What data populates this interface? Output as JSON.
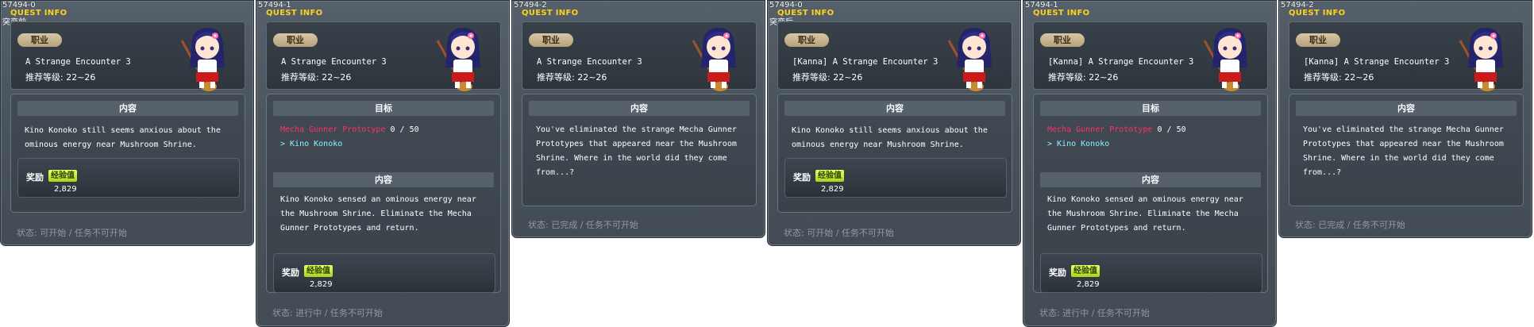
{
  "panels": [
    {
      "id": "57494-0",
      "header": "QUEST INFO",
      "sublabel": "突变前",
      "badge": "职业",
      "name": "A Strange Encounter 3",
      "level": "推荐等级: 22~26",
      "section": "内容",
      "description": [
        "Kino Konoko still seems anxious about the",
        "ominous energy near Mushroom Shrine."
      ],
      "reward_label": "奖励",
      "reward_type": "经验值",
      "reward_value": "2,829",
      "status": "状态:  可开始 / 任务不可开始"
    },
    {
      "id": "57494-1",
      "header": "QUEST INFO",
      "sublabel": "",
      "badge": "职业",
      "name": "A Strange Encounter 3",
      "level": "推荐等级: 22~26",
      "goal_label": "目标",
      "target_mob": "Mecha Gunner Prototype",
      "target_count": "0 / 50",
      "target_npc": "> Kino Konoko",
      "section": "内容",
      "description": [
        "Kino Konoko sensed an ominous energy near",
        "the Mushroom Shrine. Eliminate the Mecha",
        "Gunner Prototypes and return."
      ],
      "reward_label": "奖励",
      "reward_type": "经验值",
      "reward_value": "2,829",
      "status": "状态:  进行中 / 任务不可开始"
    },
    {
      "id": "57494-2",
      "header": "QUEST INFO",
      "sublabel": "",
      "badge": "职业",
      "name": "A Strange Encounter 3",
      "level": "推荐等级: 22~26",
      "section": "内容",
      "description": [
        "You've eliminated the strange Mecha Gunner",
        "Prototypes that appeared near the Mushroom",
        "Shrine. Where in the world did they come",
        "from...?"
      ],
      "status": "状态:  已完成 / 任务不可开始"
    },
    {
      "id": "57494-0",
      "header": "QUEST INFO",
      "sublabel": "突变后",
      "badge": "职业",
      "name": "[Kanna] A Strange Encounter 3",
      "level": "推荐等级: 22~26",
      "section": "内容",
      "description": [
        "Kino Konoko still seems anxious about the",
        "ominous energy near Mushroom Shrine."
      ],
      "reward_label": "奖励",
      "reward_type": "经验值",
      "reward_value": "2,829",
      "status": "状态:  可开始 / 任务不可开始"
    },
    {
      "id": "57494-1",
      "header": "QUEST INFO",
      "sublabel": "",
      "badge": "职业",
      "name": "[Kanna] A Strange Encounter 3",
      "level": "推荐等级: 22~26",
      "goal_label": "目标",
      "target_mob": "Mecha Gunner Prototype",
      "target_count": "0 / 50",
      "target_npc": "> Kino Konoko",
      "section": "内容",
      "description": [
        "Kino Konoko sensed an ominous energy near",
        "the Mushroom Shrine. Eliminate the Mecha",
        "Gunner Prototypes and return."
      ],
      "reward_label": "奖励",
      "reward_type": "经验值",
      "reward_value": "2,829",
      "status": "状态:  进行中 / 任务不可开始"
    },
    {
      "id": "57494-2",
      "header": "QUEST INFO",
      "sublabel": "",
      "badge": "职业",
      "name": "[Kanna] A Strange Encounter 3",
      "level": "推荐等级: 22~26",
      "section": "内容",
      "description": [
        "You've eliminated the strange Mecha Gunner",
        "Prototypes that appeared near the Mushroom",
        "Shrine. Where in the world did they come",
        "from...?"
      ],
      "status": "状态:  已完成 / 任务不可开始"
    }
  ],
  "colors": {
    "header": "#ffd21f",
    "mob": "#ff2f6a",
    "npc": "#8ff0ff",
    "status": "#8f9aa3",
    "badge": "#c8b48e"
  },
  "icons": {
    "npc_portrait": "kanna-npc-portrait-icon"
  }
}
